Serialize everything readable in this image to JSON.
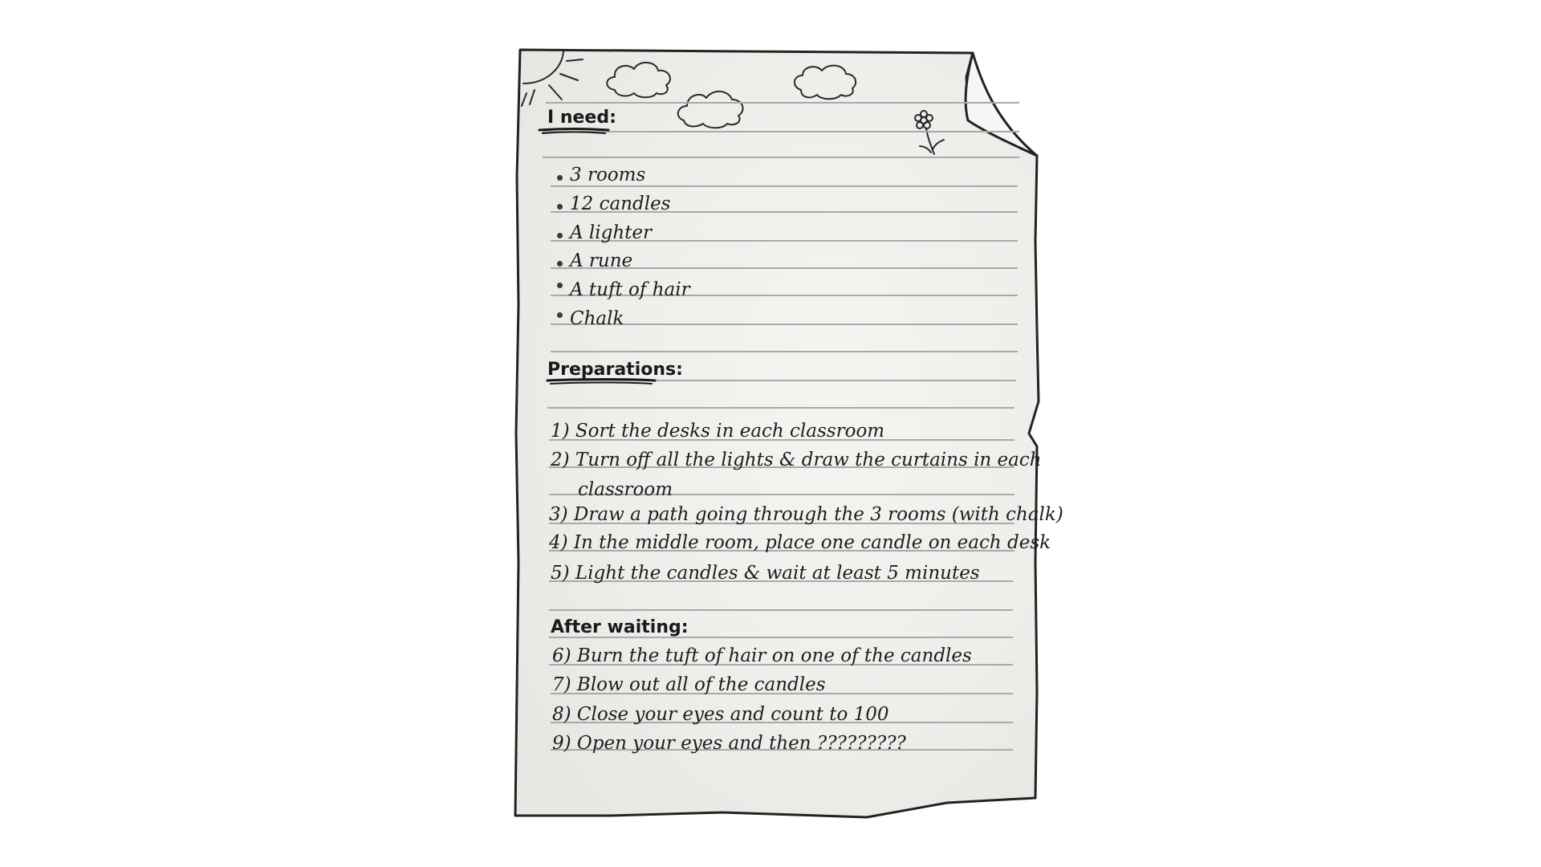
{
  "document": {
    "sections": [
      {
        "heading": "I need:",
        "items": [
          "3 rooms",
          "12 candles",
          "A lighter",
          "A rune",
          "A tuft of hair",
          "Chalk"
        ]
      },
      {
        "heading": "Preparations:",
        "items": [
          "1) Sort the desks in each classroom",
          "2) Turn off all the lights & draw the curtains in each",
          "classroom",
          "3) Draw a path going through the 3 rooms (with chalk)",
          "4) In the middle room, place one candle on each desk",
          "5) Light the candles & wait at least 5 minutes"
        ]
      },
      {
        "heading": "After waiting:",
        "items": [
          "6) Burn the tuft of hair on one of the candles",
          "7) Blow out all of the candles",
          "8) Close your eyes and count to 100",
          "9) Open your eyes and then ?????????"
        ]
      }
    ]
  },
  "colors": {
    "paper": "#f1efec",
    "ink": "#1d1d1d",
    "rule": "#a9a9a9",
    "outline": "#222222"
  },
  "icons": [
    "sun-doodle",
    "cloud-doodle",
    "flower-doodle",
    "folded-corner"
  ]
}
